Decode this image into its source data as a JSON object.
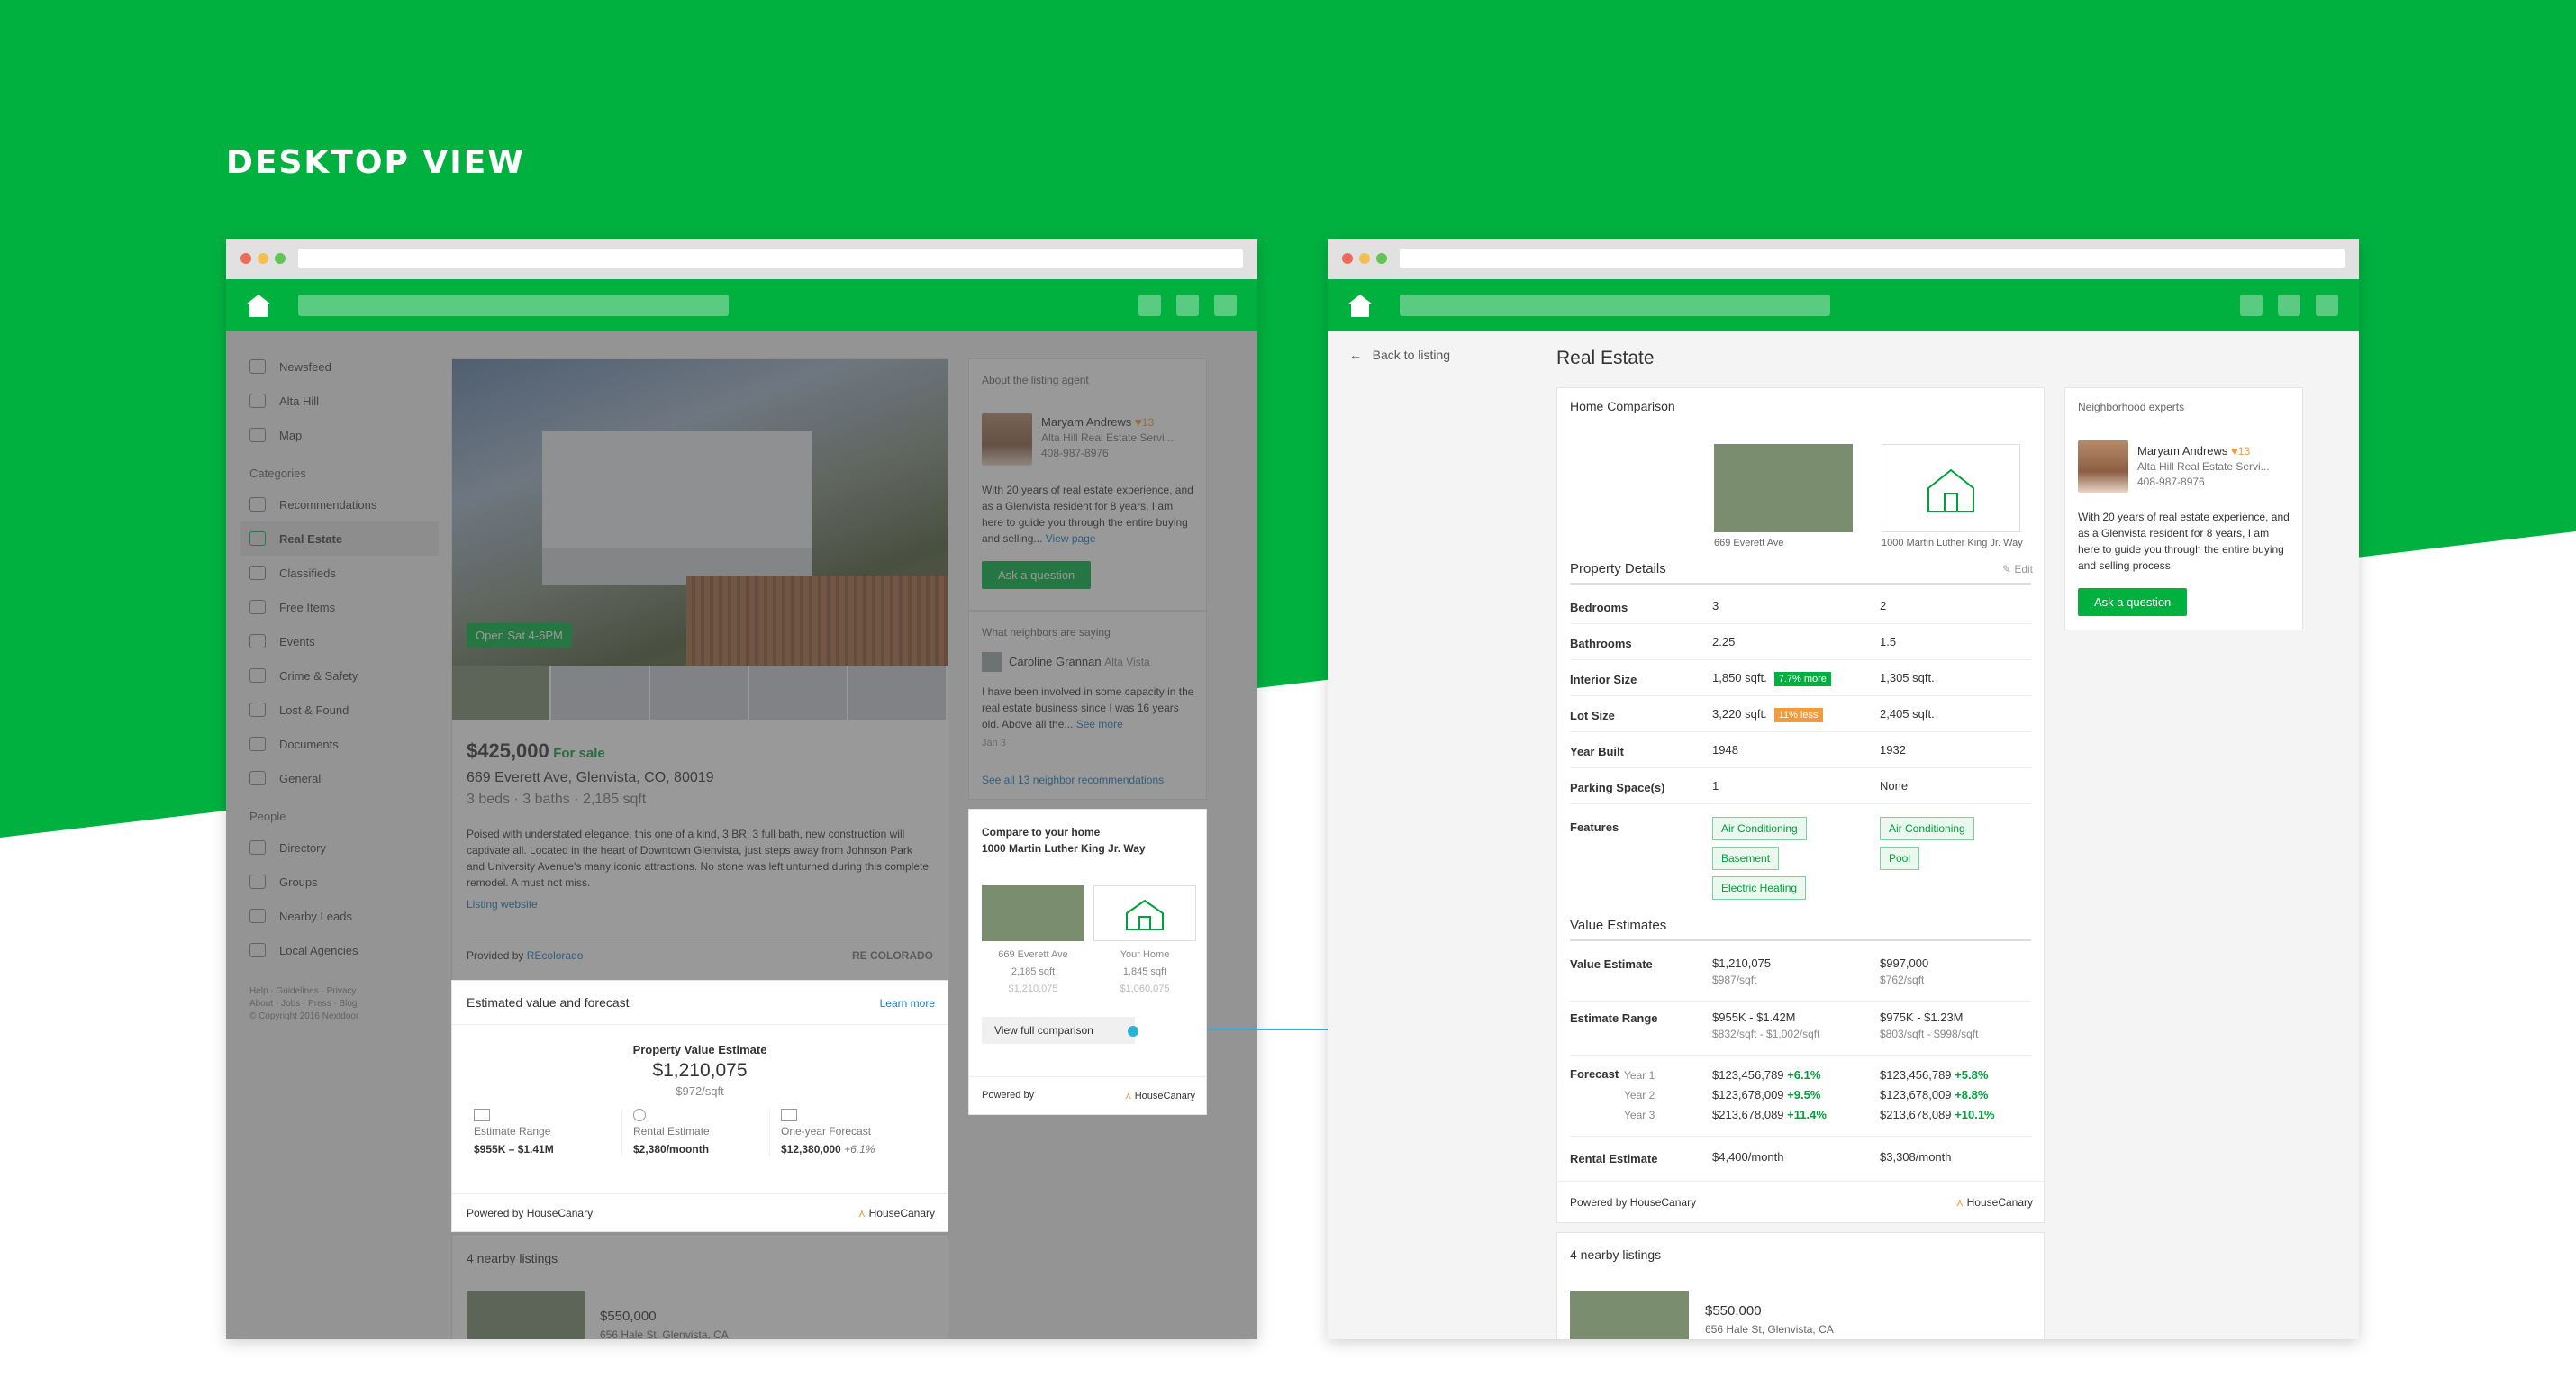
{
  "page": {
    "heading": "DESKTOP VIEW"
  },
  "colors": {
    "brand_green": "#00b140",
    "link_blue": "#1a7bbd",
    "warn_orange": "#f29b3c"
  },
  "left": {
    "sidebar": {
      "nav": [
        "Newsfeed",
        "Alta Hill",
        "Map"
      ],
      "categories_heading": "Categories",
      "categories": [
        "Recommendations",
        "Real Estate",
        "Classifieds",
        "Free Items",
        "Events",
        "Crime & Safety",
        "Lost & Found",
        "Documents",
        "General"
      ],
      "people_heading": "People",
      "people": [
        "Directory",
        "Groups",
        "Nearby Leads",
        "Local Agencies"
      ],
      "footer1": "Help · Guidelines · Privacy",
      "footer2": "About · Jobs · Press · Blog",
      "footer3": "© Copyright 2016 Nextdoor"
    },
    "listing": {
      "badge": "Open Sat 4-6PM",
      "price": "$425,000",
      "status": "For sale",
      "address": "669 Everett Ave, Glenvista, CO, 80019",
      "specs": "3 beds · 3 baths · 2,185 sqft",
      "description": "Poised with understated elegance, this one of a kind, 3 BR, 3 full bath, new construction will captivate all. Located in the heart of Downtown Glenvista, just steps away from Johnson Park and University Avenue's many iconic attractions. No stone was left unturned during this complete remodel. A must not miss.",
      "website": "Listing website",
      "provided_by": "Provided by",
      "provider": "REcolorado",
      "provider_logo": "RE COLORADO"
    },
    "estimate": {
      "title": "Estimated value and forecast",
      "learn": "Learn more",
      "label": "Property Value Estimate",
      "value": "$1,210,075",
      "per_sqft": "$972/sqft",
      "range_label": "Estimate Range",
      "range": "$955K – $1.41M",
      "rental_label": "Rental Estimate",
      "rental": "$2,380/moonth",
      "forecast_label": "One-year Forecast",
      "forecast": "$12,380,000",
      "forecast_pct": "+6.1%",
      "powered": "Powered by HouseCanary",
      "logo": "HouseCanary"
    },
    "nearby": {
      "title": "4 nearby listings",
      "price": "$550,000",
      "address": "656 Hale St, Glenvista, CA"
    },
    "agent": {
      "heading": "About the listing agent",
      "name": "Maryam Andrews",
      "hearts": "13",
      "company": "Alta Hill Real Estate Servi...",
      "phone": "408-987-8976",
      "bio": "With 20 years of real estate experience, and as a Glenvista resident for 8 years, I am here to guide you through the entire buying and selling...",
      "view_page": "View page",
      "ask": "Ask a question"
    },
    "neighbors": {
      "heading": "What neighbors are saying",
      "name": "Caroline Grannan",
      "place": "Alta Vista",
      "text": "I have been involved in some capacity in the real estate business since I was 16 years old. Above all the...",
      "see_more": "See more",
      "date": "Jan 3",
      "see_all": "See all 13 neighbor recommendations"
    },
    "compare": {
      "title": "Compare to your home",
      "address": "1000 Martin Luther King Jr. Way",
      "a_name": "669 Everett Ave",
      "a_sqft": "2,185 sqft",
      "a_price": "$1,210,075",
      "b_name": "Your Home",
      "b_sqft": "1,845 sqft",
      "b_price": "$1,060,075",
      "button": "View full comparison",
      "powered": "Powered by",
      "logo": "HouseCanary"
    }
  },
  "right": {
    "back": "Back to listing",
    "title": "Real Estate",
    "comparison": {
      "heading": "Home Comparison",
      "home_a": "669 Everett Ave",
      "home_b": "1000 Martin Luther King Jr. Way",
      "details_heading": "Property Details",
      "edit": "Edit",
      "rows": [
        {
          "label": "Bedrooms",
          "a": "3",
          "b": "2"
        },
        {
          "label": "Bathrooms",
          "a": "2.25",
          "b": "1.5"
        },
        {
          "label": "Interior Size",
          "a": "1,850 sqft.",
          "b": "1,305 sqft."
        },
        {
          "label": "Lot Size",
          "a": "3,220 sqft.",
          "b": "2,405 sqft."
        },
        {
          "label": "Year Built",
          "a": "1948",
          "b": "1932"
        },
        {
          "label": "Parking Space(s)",
          "a": "1",
          "b": "None"
        }
      ],
      "interior_badge": "7.7% more",
      "lot_badge": "11% less",
      "features_label": "Features",
      "features_a": [
        "Air Conditioning",
        "Basement",
        "Electric Heating"
      ],
      "features_b": [
        "Air Conditioning",
        "Pool"
      ],
      "estimates_heading": "Value Estimates",
      "value_label": "Value Estimate",
      "value_a": "$1,210,075",
      "value_a_sub": "$987/sqft",
      "value_b": "$997,000",
      "value_b_sub": "$762/sqft",
      "range_label": "Estimate Range",
      "range_a": "$955K - $1.42M",
      "range_a_sub": "$832/sqft - $1,002/sqft",
      "range_b": "$975K - $1.23M",
      "range_b_sub": "$803/sqft - $998/sqft",
      "forecast_label": "Forecast",
      "years": [
        "Year 1",
        "Year 2",
        "Year 3"
      ],
      "forecast_a": [
        {
          "v": "$123,456,789",
          "p": "+6.1%"
        },
        {
          "v": "$123,678,009",
          "p": "+9.5%"
        },
        {
          "v": "$213,678,089",
          "p": "+11.4%"
        }
      ],
      "forecast_b": [
        {
          "v": "$123,456,789",
          "p": "+5.8%"
        },
        {
          "v": "$123,678,009",
          "p": "+8.8%"
        },
        {
          "v": "$213,678,089",
          "p": "+10.1%"
        }
      ],
      "rental_label": "Rental Estimate",
      "rental_a": "$4,400/month",
      "rental_b": "$3,308/month",
      "powered": "Powered by HouseCanary",
      "logo": "HouseCanary"
    },
    "nearby": {
      "title": "4 nearby listings",
      "price": "$550,000",
      "address": "656 Hale St, Glenvista, CA"
    },
    "experts": {
      "heading": "Neighborhood experts",
      "name": "Maryam Andrews",
      "hearts": "13",
      "company": "Alta Hill Real Estate Servi...",
      "phone": "408-987-8976",
      "bio": "With 20 years of real estate experience, and as a Glenvista resident for 8 years, I am here to guide you through the entire buying and selling process.",
      "ask": "Ask a question"
    }
  }
}
